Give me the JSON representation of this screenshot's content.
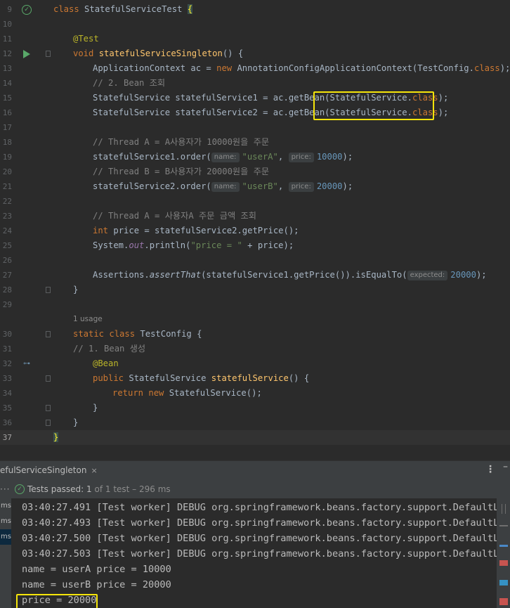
{
  "editor": {
    "line_numbers": [
      "9",
      "10",
      "11",
      "12",
      "13",
      "14",
      "15",
      "16",
      "17",
      "18",
      "19",
      "20",
      "21",
      "22",
      "23",
      "24",
      "25",
      "26",
      "27",
      "28",
      "29",
      "30",
      "31",
      "32",
      "33",
      "34",
      "35",
      "36",
      "37"
    ],
    "code": {
      "l9_kw": "class",
      "l9_name": " StatefulServiceTest ",
      "l9_brace": "{",
      "l11_ann": "@Test",
      "l12_kw": "void",
      "l12_fn": "statefulServiceSingleton",
      "l12_rest": "() {",
      "l13_a": "ApplicationContext ac = ",
      "l13_kw": "new",
      "l13_b": " AnnotationConfigApplicationContext(TestConfig.",
      "l13_kw2": "class",
      "l13_c": ");",
      "l14_cmt": "// 2. Bean 조회",
      "l15_a": "StatefulService statefulService1 = ac.getBean(StatefulService.",
      "l15_kw": "class",
      "l15_b": ");",
      "l16_a": "StatefulService statefulService2 = ac.getBean(StatefulService.",
      "l16_kw": "class",
      "l16_b": ");",
      "l18_cmt": "// Thread A = A사용자가 10000원을 주문",
      "l19_a": "statefulService1.order(",
      "l19_hint1": "name:",
      "l19_str": "\"userA\"",
      "l19_b": ", ",
      "l19_hint2": "price:",
      "l19_num": "10000",
      "l19_c": ");",
      "l20_cmt": "// Thread B = B사용자가 20000원을 주문",
      "l21_a": "statefulService2.order(",
      "l21_hint1": "name:",
      "l21_str": "\"userB\"",
      "l21_b": ", ",
      "l21_hint2": "price:",
      "l21_num": "20000",
      "l21_c": ");",
      "l23_cmt": "// Thread A = 사용자A 주문 금액 조회",
      "l24_kw": "int",
      "l24_a": " price = statefulService2.getPrice();",
      "l25_a": "System.",
      "l25_static": "out",
      "l25_b": ".println(",
      "l25_str": "\"price = \"",
      "l25_c": " + price);",
      "l27_a": "Assertions.",
      "l27_ital": "assertThat",
      "l27_b": "(statefulService1.getPrice()).isEqualTo(",
      "l27_hint": "expected:",
      "l27_num": "20000",
      "l27_c": ");",
      "l28_a": "}",
      "usage": "1 usage",
      "l30_kw": "static class",
      "l30_a": " TestConfig {",
      "l31_cmt": "// 1. Bean 생성",
      "l32_ann": "@Bean",
      "l33_kw": "public",
      "l33_a": " StatefulService ",
      "l33_fn": "statefulService",
      "l33_b": "() {",
      "l34_kw": "return new",
      "l34_a": " StatefulService();",
      "l35_a": "}",
      "l36_a": "}",
      "l37_a": "}"
    }
  },
  "run_panel": {
    "tab_label": "efulServiceSingleton",
    "tab_close": "×",
    "menu_glyph": "⋮",
    "minimize_glyph": "–",
    "status": {
      "dots": "···",
      "passed_label": "Tests passed: ",
      "passed_count": "1",
      "of_total": " of 1 test – 296 ms"
    },
    "tree_items": [
      "ms",
      "ms",
      "ms"
    ],
    "console_lines": [
      "03:40:27.491 [Test worker] DEBUG org.springframework.beans.factory.support.DefaultLis",
      "03:40:27.493 [Test worker] DEBUG org.springframework.beans.factory.support.DefaultLis",
      "03:40:27.500 [Test worker] DEBUG org.springframework.beans.factory.support.DefaultLis",
      "03:40:27.503 [Test worker] DEBUG org.springframework.beans.factory.support.DefaultLis",
      "name = userA price = 10000",
      "name = userB price = 20000",
      "price = 20000"
    ]
  },
  "colors": {
    "highlight_box": "#f5e50a",
    "pass_green": "#59a869",
    "keyword": "#cc7832",
    "function": "#ffc66d"
  },
  "icons": [
    "check-icon",
    "play-icon",
    "fold-icon",
    "bean-icon",
    "close-icon",
    "kebab-menu-icon",
    "minimize-icon"
  ]
}
